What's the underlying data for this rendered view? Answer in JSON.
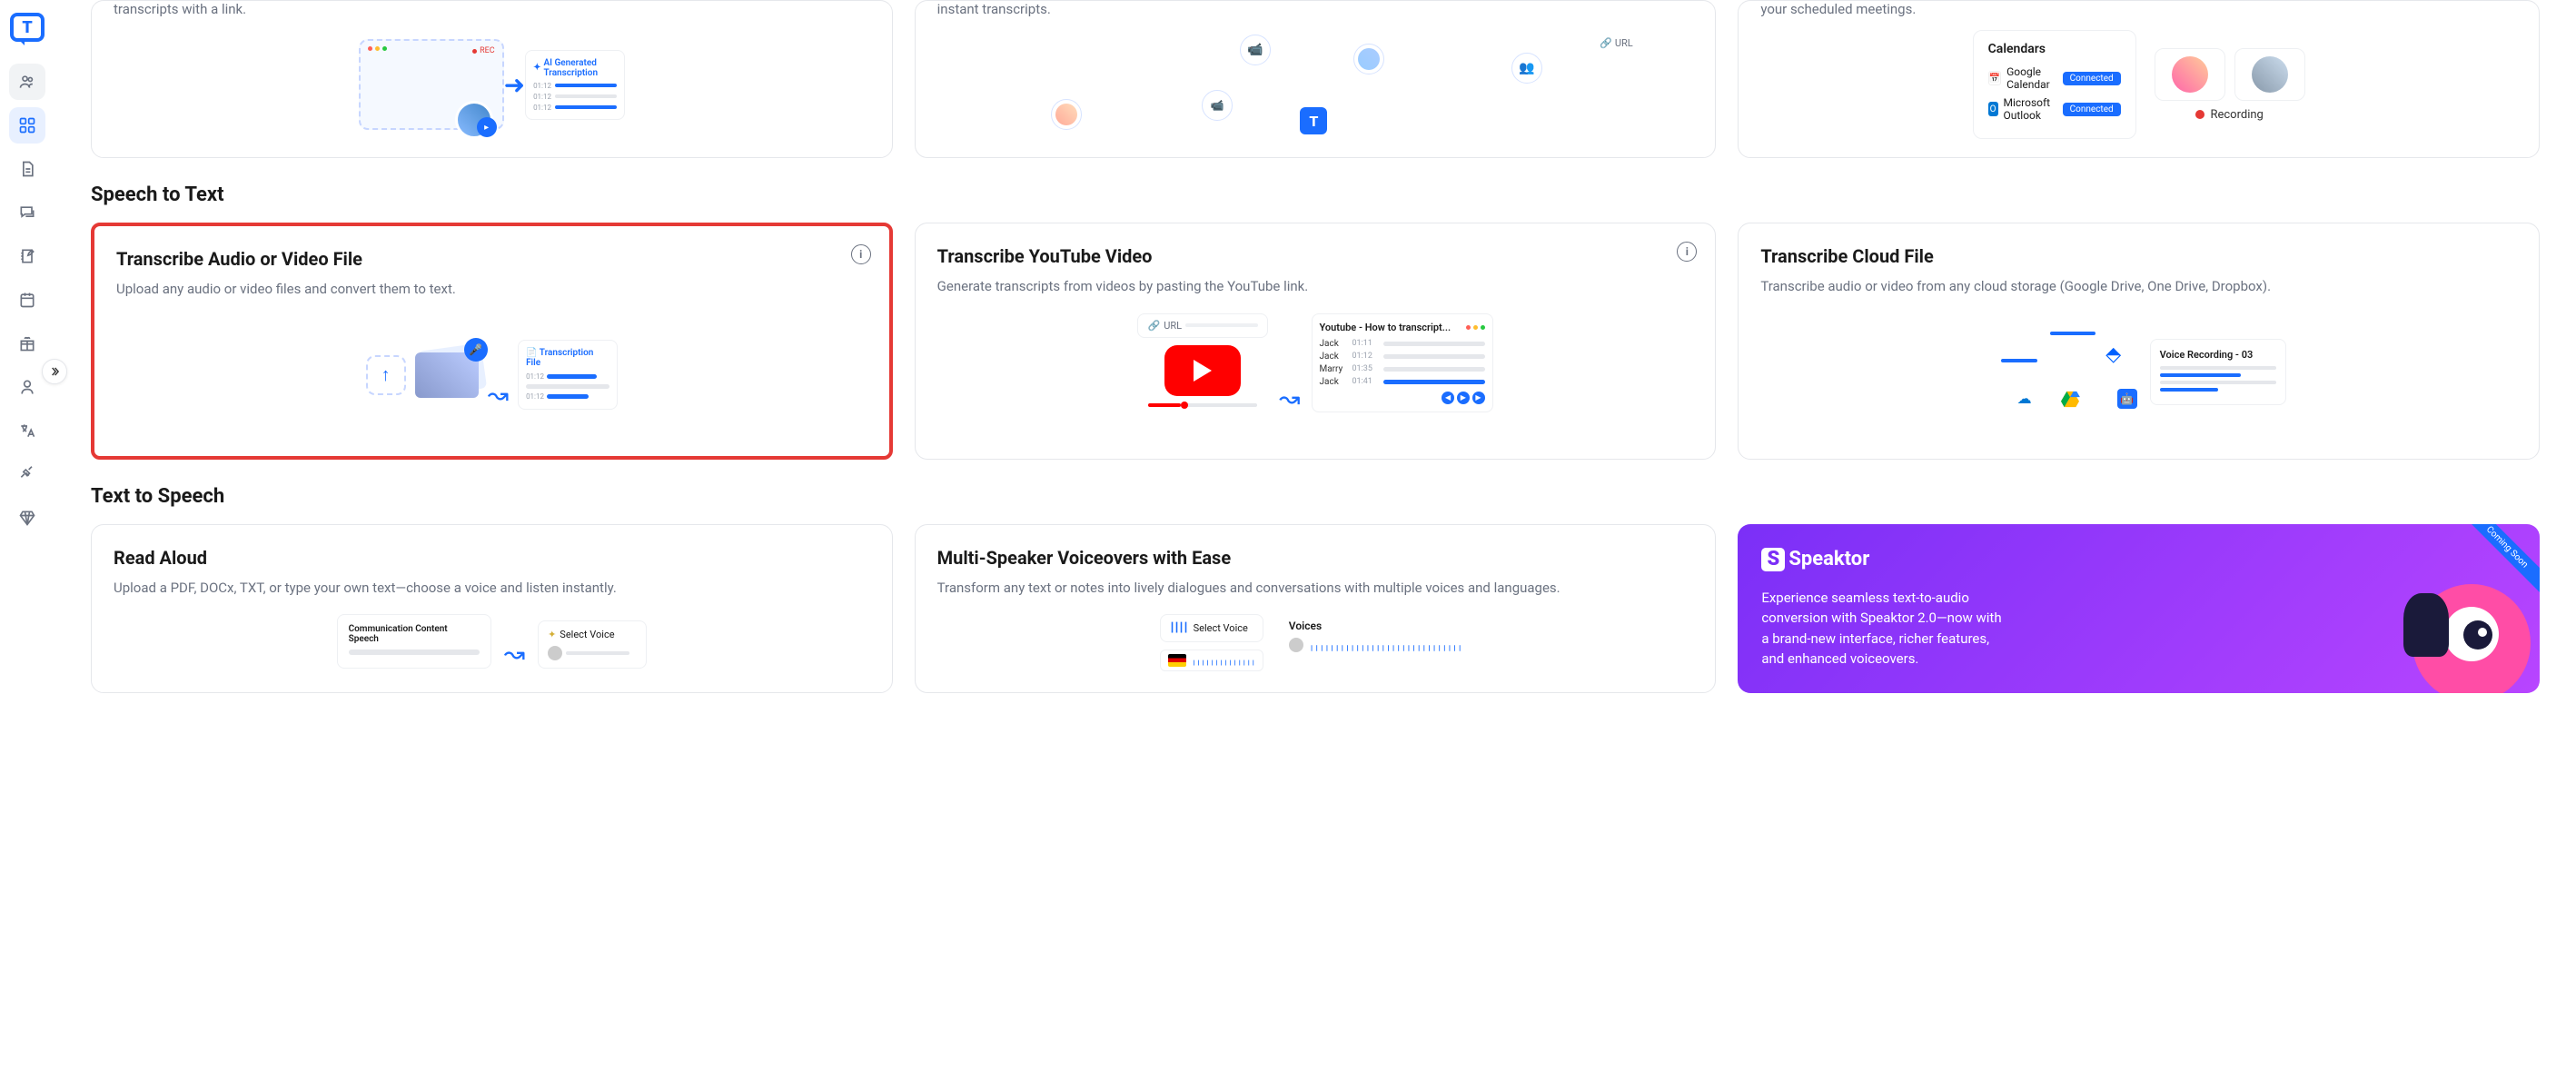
{
  "sidebar": {
    "nav": [
      {
        "name": "people",
        "active": false
      },
      {
        "name": "dashboard",
        "active": true
      },
      {
        "name": "document",
        "active": false
      },
      {
        "name": "chat",
        "active": false
      },
      {
        "name": "notes",
        "active": false
      },
      {
        "name": "calendar",
        "active": false
      },
      {
        "name": "gift",
        "active": false
      },
      {
        "name": "profile",
        "active": false
      },
      {
        "name": "translate",
        "active": false
      },
      {
        "name": "plugin",
        "active": false
      },
      {
        "name": "diamond",
        "active": false
      }
    ]
  },
  "top_cards": [
    {
      "desc_fragment": "transcripts with a link.",
      "illustration": {
        "ai_label": "AI Generated Transcription",
        "rec": "REC",
        "times": [
          "01:12",
          "01:12",
          "01:12"
        ]
      }
    },
    {
      "desc_fragment": "instant transcripts.",
      "illustration": {
        "url_label": "URL"
      }
    },
    {
      "desc_fragment": "your scheduled meetings.",
      "illustration": {
        "calendars_title": "Calendars",
        "google": "Google Calendar",
        "outlook": "Microsoft Outlook",
        "connected": "Connected",
        "recording": "Recording"
      }
    }
  ],
  "sections": {
    "speech_to_text": {
      "title": "Speech to Text",
      "cards": [
        {
          "title": "Transcribe Audio or Video File",
          "desc": "Upload any audio or video files and convert them to text.",
          "highlighted": true,
          "has_info": true,
          "illustration": {
            "file_label": "Transcription File",
            "time": "01:12"
          }
        },
        {
          "title": "Transcribe YouTube Video",
          "desc": "Generate transcripts from videos by pasting the YouTube link.",
          "has_info": true,
          "illustration": {
            "url_label": "URL",
            "panel_title": "Youtube - How to transcript...",
            "rows": [
              {
                "name": "Jack",
                "time": "01:11"
              },
              {
                "name": "Jack",
                "time": "01:12"
              },
              {
                "name": "Marry",
                "time": "01:35"
              },
              {
                "name": "Jack",
                "time": "01:41"
              }
            ]
          }
        },
        {
          "title": "Transcribe Cloud File",
          "desc": "Transcribe audio or video from any cloud storage (Google Drive, One Drive, Dropbox).",
          "has_info": false,
          "illustration": {
            "record_title": "Voice Recording - 03"
          }
        }
      ]
    },
    "text_to_speech": {
      "title": "Text to Speech",
      "cards": [
        {
          "title": "Read Aloud",
          "desc": "Upload a PDF, DOCx, TXT, or type your own text—choose a voice and listen instantly.",
          "illustration": {
            "panel_title": "Communication Content Speech",
            "select_label": "Select Voice"
          }
        },
        {
          "title": "Multi-Speaker Voiceovers with Ease",
          "desc": "Transform any text or notes into lively dialogues and conversations with multiple voices and languages.",
          "illustration": {
            "select_label": "Select Voice",
            "voices_label": "Voices"
          }
        },
        {
          "speaktor": true,
          "brand": "Speaktor",
          "text": "Experience seamless text-to-audio conversion with Speaktor 2.0—now with a brand-new interface, richer features, and enhanced voiceovers.",
          "ribbon": "Coming Soon"
        }
      ]
    }
  }
}
